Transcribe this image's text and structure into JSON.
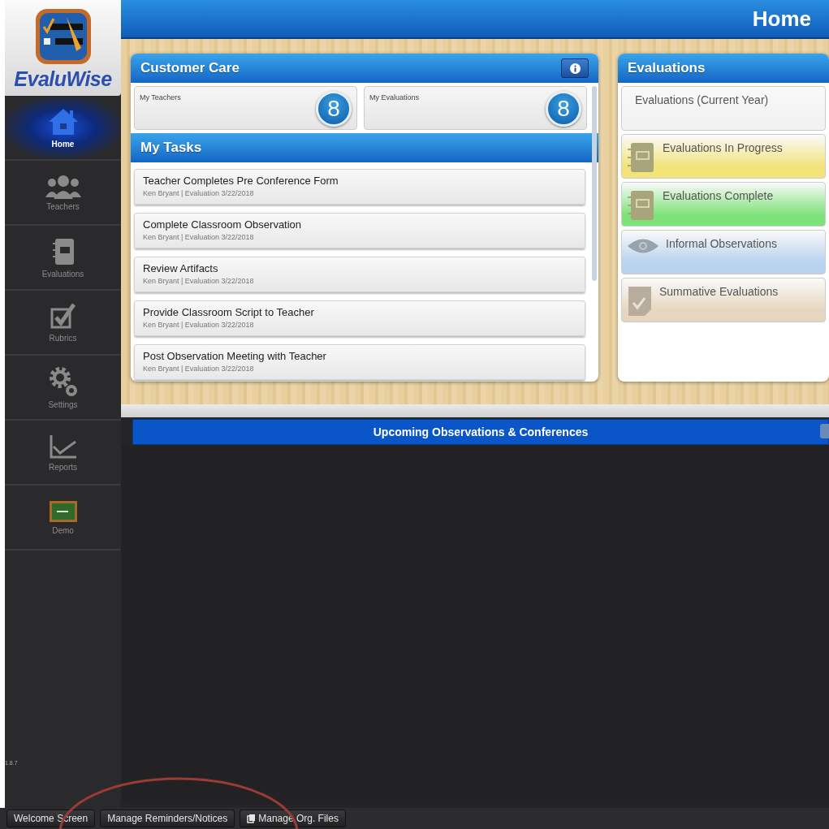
{
  "logo": {
    "text": "EvaluWise"
  },
  "sidebar": {
    "items": [
      {
        "label": "Home",
        "selected": true
      },
      {
        "label": "Teachers",
        "selected": false
      },
      {
        "label": "Evaluations",
        "selected": false
      },
      {
        "label": "Rubrics",
        "selected": false
      },
      {
        "label": "Settings",
        "selected": false
      },
      {
        "label": "Reports",
        "selected": false
      },
      {
        "label": "Demo",
        "selected": false
      }
    ],
    "version": "1.8.7"
  },
  "header": {
    "title": "Home"
  },
  "customer_care": {
    "title": "Customer Care",
    "stats": [
      {
        "label": "My Teachers",
        "count": "8"
      },
      {
        "label": "My Evaluations",
        "count": "8"
      }
    ]
  },
  "my_tasks": {
    "title": "My Tasks",
    "tasks": [
      {
        "title": "Teacher Completes Pre Conference Form",
        "detail": "Ken Bryant | Evaluation 3/22/2018"
      },
      {
        "title": "Complete Classroom Observation",
        "detail": "Ken Bryant | Evaluation 3/22/2018"
      },
      {
        "title": "Review Artifacts",
        "detail": "Ken Bryant | Evaluation 3/22/2018"
      },
      {
        "title": "Provide Classroom Script to Teacher",
        "detail": "Ken Bryant | Evaluation 3/22/2018"
      },
      {
        "title": "Post Observation Meeting with Teacher",
        "detail": "Ken Bryant | Evaluation 3/22/2018"
      }
    ]
  },
  "evaluations": {
    "title": "Evaluations",
    "items": [
      {
        "label": "Evaluations (Current Year)",
        "kind": "plain",
        "color": "#f2f2f2"
      },
      {
        "label": "Evaluations In Progress",
        "kind": "notebook",
        "color": "#f2e37a"
      },
      {
        "label": "Evaluations Complete",
        "kind": "notebook",
        "color": "#7ee27a"
      },
      {
        "label": "Informal Observations",
        "kind": "eye",
        "color": "#b9d2ee"
      },
      {
        "label": "Summative Evaluations",
        "kind": "document",
        "color": "#e6d6c0"
      }
    ]
  },
  "upcoming": {
    "title": "Upcoming Observations & Conferences"
  },
  "bottom_bar": {
    "buttons": [
      {
        "label": "Welcome Screen",
        "kind": "plain"
      },
      {
        "label": "Manage Reminders/Notices",
        "kind": "plain"
      },
      {
        "label": "Manage Org. Files",
        "kind": "files"
      }
    ]
  }
}
